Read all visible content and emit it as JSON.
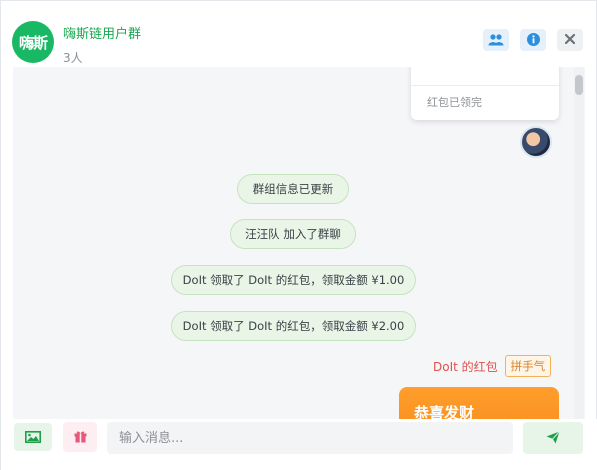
{
  "header": {
    "avatar_text": "嗨斯",
    "group_name": "嗨斯链用户群",
    "member_count": "3人",
    "buttons": {
      "members_icon": "users-icon",
      "info_icon": "info-icon",
      "close_icon": "close-icon"
    }
  },
  "chat": {
    "red_packet_card": {
      "status": "红包已领完"
    },
    "system_messages": [
      "群组信息已更新",
      "汪汪队 加入了群聊",
      "DoIt 领取了 DoIt 的红包，领取金额 ¥1.00",
      "DoIt 领取了 DoIt 的红包，领取金额 ¥2.00"
    ],
    "red_packet_message": {
      "sender_label": "DoIt 的红包",
      "type_tag": "拼手气",
      "greeting": "恭喜发财"
    }
  },
  "input_bar": {
    "image_icon": "image-icon",
    "gift_icon": "gift-icon",
    "placeholder": "输入消息...",
    "value": "",
    "send_icon": "send-icon"
  },
  "colors": {
    "brand_green": "#19b865",
    "group_name_green": "#18a84f",
    "red_packet_orange": "#f58a1a",
    "red_label": "#e0504d"
  }
}
